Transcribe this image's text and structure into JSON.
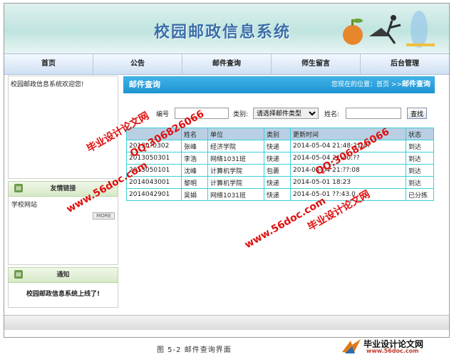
{
  "banner": {
    "title": "校园邮政信息系统"
  },
  "nav": [
    "首页",
    "公告",
    "邮件查询",
    "师生留言",
    "后台管理"
  ],
  "sidebar": {
    "welcome": "校园邮政信息系统欢迎您!",
    "links_heading": "友情链接",
    "links_item": "学校网站",
    "more_label": "MORE",
    "notice_heading": "通知",
    "notice_text": "校园邮政信息系统上线了!"
  },
  "main": {
    "title": "邮件查询",
    "location_prefix": "您现在的位置：首页 >>",
    "location_current": "邮件查询"
  },
  "search": {
    "id_label": "编号",
    "type_label": "类别:",
    "type_selected": "请选择邮件类型",
    "name_label": "姓名:",
    "button": "查找"
  },
  "table": {
    "headers": [
      "",
      "姓名",
      "单位",
      "类别",
      "更新时间",
      "状态"
    ],
    "rows": [
      [
        "20130?0302",
        "张峰",
        "经济学院",
        "快递",
        "2014-05-04 21:48:21.4?",
        "到达"
      ],
      [
        "2013050301",
        "李浩",
        "网络1031班",
        "快递",
        "2014-05-04 21:40:??",
        "到达"
      ],
      [
        "2013050101",
        "沈峰",
        "计算机学院",
        "包裹",
        "2014-05-04 21:??:08",
        "到达"
      ],
      [
        "2014043001",
        "黎明",
        "计算机学院",
        "快递",
        "2014-05-01 18:23",
        "到达"
      ],
      [
        "2014042901",
        "吴娟",
        "网络1031班",
        "快递",
        "2014-05-01 ??:43.0",
        "已分拣"
      ]
    ]
  },
  "caption": "图 5-2   邮件查询界面",
  "watermark": {
    "site": "www.56doc.com",
    "qq": "QQ:306826066",
    "brand": "毕业设计论文网"
  },
  "logo": {
    "line1": "毕业设计论文网",
    "line2": "www.56doc.com"
  }
}
